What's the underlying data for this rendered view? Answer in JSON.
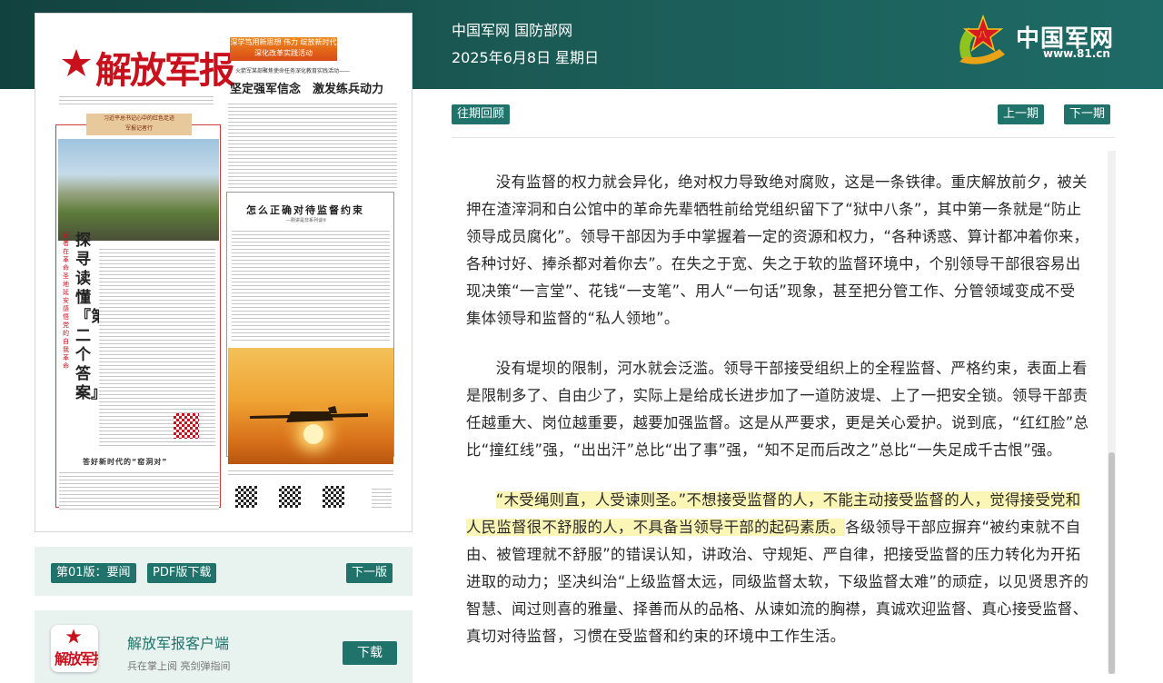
{
  "header": {
    "site_name": "中国军网 国防部网",
    "date": "2025年6月8日 星期日",
    "logo": {
      "text": "中国军网",
      "url": "www.81.cn",
      "icon": "star-logo-icon"
    }
  },
  "newspaper": {
    "masthead": "解放军报",
    "promo_lines": [
      "深学笃用新思想 伟力  绽放新时代",
      "深化改革实践活动"
    ],
    "lead_subtitle": "火箭军某部聚焦使命任务深化教育实践活动——",
    "lead_headline": "坚定强军信念　激发练兵动力",
    "column_banner": [
      "习近平总书记心中的红色足迹",
      "军报记者行"
    ],
    "feature_title": "探寻读懂『第二个答案』",
    "feature_subtitle": "记者在革命圣地延安感悟党的自我革命",
    "commentary_title": "怎么正确对待监督约束",
    "commentary_subtitle": "—刚讲是非系列谈⑤",
    "bottom_title": "答好新时代的“窑洞对”"
  },
  "issue_nav": {
    "page_label": "第01版：要闻",
    "pdf_label": "PDF版下载",
    "next_page_label": "下一版"
  },
  "app_card": {
    "icon_text": "解放军报",
    "name": "解放军报客户端",
    "desc": "兵在掌上阅 亮剑弹指间",
    "download_label": "下载"
  },
  "toolbar": {
    "archive_label": "往期回顾",
    "prev_label": "上一期",
    "next_label": "下一期"
  },
  "article": {
    "paragraphs": [
      "没有监督的权力就会异化，绝对权力导致绝对腐败，这是一条铁律。重庆解放前夕，被关押在渣滓洞和白公馆中的革命先辈牺牲前给党组织留下了“狱中八条”，其中第一条就是“防止领导成员腐化”。领导干部因为手中掌握着一定的资源和权力，“各种诱惑、算计都冲着你来，各种讨好、捧杀都对着你去”。在失之于宽、失之于软的监督环境中，个别领导干部很容易出现决策“一言堂”、花钱“一支笔”、用人“一句话”现象，甚至把分管工作、分管领域变成不受集体领导和监督的“私人领地”。",
      "没有堤坝的限制，河水就会泛滥。领导干部接受组织上的全程监督、严格约束，表面上看是限制多了、自由少了，实际上是给成长进步加了一道防波堤、上了一把安全锁。领导干部责任越重大、岗位越重要，越要加强监督。这是从严要求，更是关心爱护。说到底，“红红脸”总比“撞红线”强，“出出汗”总比“出了事”强，“知不足而后改之”总比“一失足成千古恨”强。"
    ],
    "p3_highlight": "“木受绳则直，人受谏则圣。”不想接受监督的人，不能主动接受监督的人，觉得接受党和人民监督很不舒服的人，不具备当领导干部的起码素质。",
    "p3_rest": "各级领导干部应摒弃“被约束就不自由、被管理就不舒服”的错误认知，讲政治、守规矩、严自律，把接受监督的压力转化为开拓进取的动力；坚决纠治“上级监督太远，同级监督太软，下级监督太难”的顽症，以见贤思齐的智慧、闻过则喜的雅量、择善而从的品格、从谏如流的胸襟，真诚欢迎监督、真心接受监督、真切对待监督，习惯在受监督和约束的环境中工作生活。"
  },
  "colors": {
    "accent": "#20736b",
    "header_bg": "#1b5a55",
    "highlight": "#fbf6b6",
    "brand_red": "#c8111c"
  }
}
